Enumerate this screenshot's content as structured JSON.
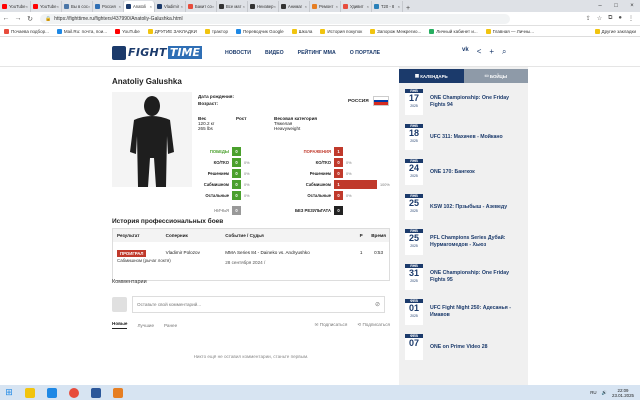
{
  "browser": {
    "tabs": [
      {
        "label": "YouTube",
        "color": "#ff0000"
      },
      {
        "label": "YouTube",
        "color": "#ff0000"
      },
      {
        "label": "Вы в сос",
        "color": "#4a76a8"
      },
      {
        "label": "Россия",
        "color": "#2f6fb5"
      },
      {
        "label": "Anatoli",
        "color": "#1b3a6b",
        "active": true
      },
      {
        "label": "Vladimir",
        "color": "#1b3a6b"
      },
      {
        "label": "Бакит со",
        "color": "#e74c3c"
      },
      {
        "label": "Все мат",
        "color": "#333"
      },
      {
        "label": "Неизвер",
        "color": "#333"
      },
      {
        "label": "Анимаг",
        "color": "#333"
      },
      {
        "label": "Ремонт",
        "color": "#e67e22"
      },
      {
        "label": "Удивит",
        "color": "#e74c3c"
      },
      {
        "label": "T20 - 8",
        "color": "#2980b9"
      }
    ],
    "new_tab": "+",
    "url": "https://fighttime.ru/fighters/437990/Anatoliy-Galushka.html",
    "bookmarks": [
      {
        "label": "Почаева подбор...",
        "color": "#e74c3c"
      },
      {
        "label": "Mail.Ru: почта, пои...",
        "color": "#1e88e5"
      },
      {
        "label": "YouTube",
        "color": "#ff0000"
      },
      {
        "label": "ДРУГИЕ ЗАКЛАДКИ",
        "color": "#f1c40f"
      },
      {
        "label": "трактор",
        "color": "#f1c40f"
      },
      {
        "label": "Переводчик Google",
        "color": "#1e88e5"
      },
      {
        "label": "Школа",
        "color": "#f1c40f"
      },
      {
        "label": "История покупок",
        "color": "#f1c40f"
      },
      {
        "label": "Запорож Межрегио...",
        "color": "#f1c40f"
      },
      {
        "label": "Личный кабинет и...",
        "color": "#27ae60"
      },
      {
        "label": "Главная — Личны...",
        "color": "#f1c40f"
      }
    ],
    "other_bookmarks": "Другие закладки"
  },
  "site": {
    "logo_part1": "FIGHT",
    "logo_part2": "TIME",
    "nav": [
      "НОВОСТИ",
      "ВИДЕО",
      "РЕЙТИНГ ММА",
      "О ПОРТАЛЕ"
    ]
  },
  "fighter": {
    "name": "Anatoliy Galushka",
    "birth_label": "Дата рождения:",
    "age_label": "Возраст:",
    "country": "РОССИЯ",
    "flag_colors": [
      "#ffffff",
      "#0039a6",
      "#d52b1e"
    ],
    "weight_label": "Вес",
    "height_label": "Рост",
    "weight_kg": "120.2 кг",
    "weight_lbs": "265 lbs",
    "class_label": "Весовая категория",
    "class_ru": "Тяжелая",
    "class_en": "Heavyweight"
  },
  "stats": {
    "wins": {
      "title": "ПОБЕДЫ",
      "total": "0",
      "rows": [
        {
          "label": "КО/ТКО",
          "value": "0",
          "pct": "0%"
        },
        {
          "label": "Решением",
          "value": "0",
          "pct": "0%"
        },
        {
          "label": "Сабмишном",
          "value": "0",
          "pct": "0%"
        },
        {
          "label": "Остальные",
          "value": "0",
          "pct": "0%"
        }
      ],
      "color": "#4aa02c"
    },
    "losses": {
      "title": "ПОРАЖЕНИЯ",
      "total": "1",
      "rows": [
        {
          "label": "КО/ТКО",
          "value": "0",
          "pct": "0%"
        },
        {
          "label": "Решением",
          "value": "0",
          "pct": "0%"
        },
        {
          "label": "Сабмишном",
          "value": "1",
          "pct": "100%",
          "fill": 1
        },
        {
          "label": "Остальные",
          "value": "0",
          "pct": "0%"
        }
      ],
      "color": "#c0392b"
    },
    "draw_label": "НИЧЬЯ",
    "draw_value": "0",
    "nc_label": "БЕЗ РЕЗУЛЬТАТА",
    "nc_value": "0"
  },
  "history": {
    "title": "История профессиональных боев",
    "headers": [
      "Результат",
      "Соперник",
      "Событие / Судья",
      "Р",
      "Время"
    ],
    "fight": {
      "result": "ПРОИГРАЛ",
      "opponent": "Vladimir Polozov",
      "event": "MMA Series 84 - Daineko vs. Andryushko",
      "date": "28 сентября 2024 /",
      "round": "1",
      "time": "0:53",
      "method": "Сабмишном (рычаг локтя)"
    }
  },
  "comments": {
    "title": "Комментарии",
    "placeholder": "Оставьте свой комментарий...",
    "tabs": [
      "Новые",
      "Лучшие",
      "Ранее"
    ],
    "subscribe": "Подписаться",
    "subscribe2": "Подписаться",
    "empty": "Никто ещё не оставил комментарии, станьте первым."
  },
  "sidebar": {
    "tab_calendar": "КАЛЕНДАРЬ",
    "tab_fights": "БОЙЦЫ",
    "events": [
      {
        "month": "ЯНВ",
        "day": "17",
        "year": "2025",
        "title": "ONE Championship: One Friday Fights 94"
      },
      {
        "month": "ЯНВ",
        "day": "18",
        "year": "2025",
        "title": "UFC 311: Махачев - Мойкано"
      },
      {
        "month": "ЯНВ",
        "day": "24",
        "year": "2025",
        "title": "ONE 170: Бангкок"
      },
      {
        "month": "ЯНВ",
        "day": "25",
        "year": "2025",
        "title": "KSW 102: Прзыбыш - Азеведу"
      },
      {
        "month": "ЯНВ",
        "day": "25",
        "year": "2025",
        "title": "PFL Champions Series Дубай: Нурмагомедов - Хьюз"
      },
      {
        "month": "ЯНВ",
        "day": "31",
        "year": "2025",
        "title": "ONE Championship: One Friday Fights 95"
      },
      {
        "month": "ФЕВ",
        "day": "01",
        "year": "2025",
        "title": "UFC Fight Night 250: Адесанья - Имавов"
      },
      {
        "month": "ФЕВ",
        "day": "07",
        "year": "",
        "title": "ONE on Prime Video 28"
      }
    ]
  },
  "taskbar": {
    "lang": "RU",
    "time": "22:09",
    "date": "23.01.2025"
  }
}
